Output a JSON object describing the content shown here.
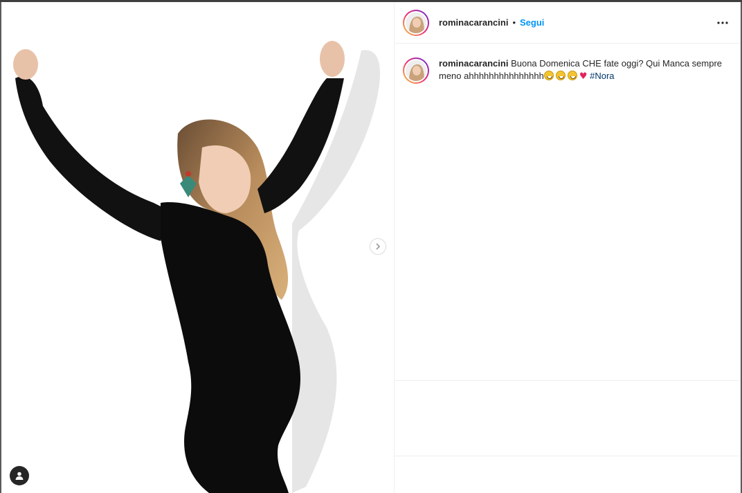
{
  "post": {
    "username": "rominacarancini",
    "separator": "•",
    "follow_label": "Segui",
    "caption_user": "rominacarancini",
    "caption_text": "Buona Domenica CHE fate oggi? Qui Manca sempre meno ahhhhhhhhhhhhhhh",
    "hashtag": "#Nora"
  },
  "icons": {
    "more": "more-horizontal-icon",
    "next": "chevron-right-icon",
    "tag": "user-tag-icon"
  },
  "colors": {
    "follow": "#0095f6",
    "hashtag": "#00376b",
    "text": "#262626"
  }
}
